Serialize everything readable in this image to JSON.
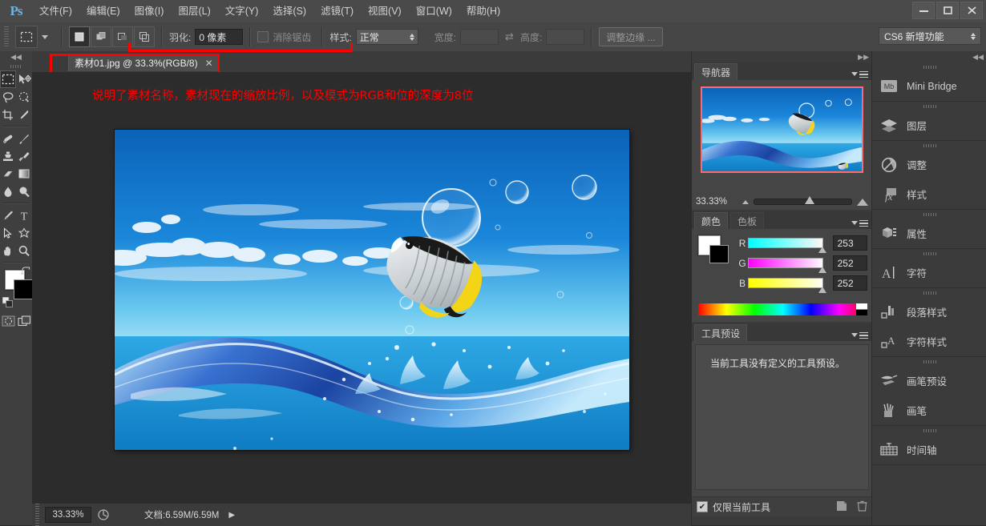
{
  "window": {
    "logo": "Ps",
    "controls": {
      "minimize": "—",
      "maximize": "▢",
      "close": "✕"
    }
  },
  "menubar": {
    "items": [
      {
        "label": "文件(F)",
        "name": "menu-file"
      },
      {
        "label": "编辑(E)",
        "name": "menu-edit"
      },
      {
        "label": "图像(I)",
        "name": "menu-image"
      },
      {
        "label": "图层(L)",
        "name": "menu-layer"
      },
      {
        "label": "文字(Y)",
        "name": "menu-type"
      },
      {
        "label": "选择(S)",
        "name": "menu-select"
      },
      {
        "label": "滤镜(T)",
        "name": "menu-filter"
      },
      {
        "label": "视图(V)",
        "name": "menu-view"
      },
      {
        "label": "窗口(W)",
        "name": "menu-window"
      },
      {
        "label": "帮助(H)",
        "name": "menu-help"
      }
    ]
  },
  "options_bar": {
    "feather_label": "羽化:",
    "feather_value": "0 像素",
    "antialias_label": "消除锯齿",
    "antialias_checked": false,
    "style_label": "样式:",
    "style_value": "正常",
    "width_label": "宽度:",
    "width_value": "",
    "height_label": "高度:",
    "height_value": "",
    "refine_edge_label": "调整边缘 ...",
    "workspace_label": "CS6 新增功能",
    "swap_icon": "⇄"
  },
  "document_tab": {
    "title": "素材01.jpg @ 33.3%(RGB/8)",
    "close_icon": "✕"
  },
  "annotation": {
    "text": "说明了素材名称，素材现在的缩放比例，以及模式为RGB和位的深度为8位",
    "color": "#ff0000"
  },
  "statusbar": {
    "zoom": "33.33%",
    "doc_info": "文档:6.59M/6.59M",
    "arrow_icon": "▶"
  },
  "toolbox": {
    "collapse_icon": "◀◀",
    "tools": [
      {
        "name": "tool-rectangular-marquee",
        "selected": true
      },
      {
        "name": "tool-move",
        "selected": false
      },
      {
        "name": "tool-lasso",
        "selected": false
      },
      {
        "name": "tool-quick-selection",
        "selected": false
      },
      {
        "name": "tool-crop",
        "selected": false
      },
      {
        "name": "tool-eyedropper",
        "selected": false
      },
      {
        "name": "tool-spot-healing-brush",
        "selected": false
      },
      {
        "name": "tool-brush",
        "selected": false
      },
      {
        "name": "tool-clone-stamp",
        "selected": false
      },
      {
        "name": "tool-history-brush",
        "selected": false
      },
      {
        "name": "tool-eraser",
        "selected": false
      },
      {
        "name": "tool-gradient",
        "selected": false
      },
      {
        "name": "tool-blur",
        "selected": false
      },
      {
        "name": "tool-dodge",
        "selected": false
      },
      {
        "name": "tool-pen",
        "selected": false
      },
      {
        "name": "tool-horizontal-type",
        "selected": false
      },
      {
        "name": "tool-path-selection",
        "selected": false
      },
      {
        "name": "tool-custom-shape",
        "selected": false
      },
      {
        "name": "tool-hand",
        "selected": false
      },
      {
        "name": "tool-zoom",
        "selected": false
      }
    ],
    "foreground_color": "#ffffff",
    "background_color": "#000000",
    "swap_icon": "⤡"
  },
  "navigator": {
    "tab_label": "导航器",
    "zoom_value": "33.33%",
    "thumb_border_color": "#ff6b6b"
  },
  "color_panel": {
    "tabs": [
      {
        "label": "颜色",
        "active": true
      },
      {
        "label": "色板",
        "active": false
      }
    ],
    "channels": [
      {
        "label": "R",
        "value": "253",
        "gradient_from": "#00ffff",
        "gradient_to": "#fff7f7"
      },
      {
        "label": "G",
        "value": "252",
        "gradient_from": "#ff00ff",
        "gradient_to": "#fdf9fd"
      },
      {
        "label": "B",
        "value": "252",
        "gradient_from": "#ffff00",
        "gradient_to": "#fdfdf5"
      }
    ],
    "foreground_color": "#ffffff",
    "background_color": "#000000"
  },
  "tool_presets": {
    "tab_label": "工具预设",
    "empty_message": "当前工具没有定义的工具预设。",
    "current_tool_only_label": "仅限当前工具",
    "current_tool_only_checked": true,
    "check_glyph": "✔"
  },
  "icon_dock": {
    "collapse_icon": "◀◀",
    "groups": [
      {
        "items": [
          {
            "label": "Mini Bridge",
            "icon": "mini-bridge-icon"
          }
        ]
      },
      {
        "items": [
          {
            "label": "图层",
            "icon": "layers-icon"
          }
        ]
      },
      {
        "items": [
          {
            "label": "调整",
            "icon": "adjustments-icon"
          },
          {
            "label": "样式",
            "icon": "styles-icon"
          }
        ]
      },
      {
        "items": [
          {
            "label": "属性",
            "icon": "properties-icon"
          }
        ]
      },
      {
        "items": [
          {
            "label": "字符",
            "icon": "character-icon"
          }
        ]
      },
      {
        "items": [
          {
            "label": "段落样式",
            "icon": "paragraph-styles-icon"
          },
          {
            "label": "字符样式",
            "icon": "character-styles-icon"
          }
        ]
      },
      {
        "items": [
          {
            "label": "画笔预设",
            "icon": "brush-presets-icon"
          },
          {
            "label": "画笔",
            "icon": "brush-icon"
          }
        ]
      },
      {
        "items": [
          {
            "label": "时间轴",
            "icon": "timeline-icon"
          }
        ]
      }
    ]
  },
  "artwork": {
    "description": "蓝天白云、水花与蝴蝶鱼合成图",
    "sky_top": "#1577d0",
    "sky_bottom": "#6fd9f5",
    "water_color": "#2a5fbb"
  }
}
